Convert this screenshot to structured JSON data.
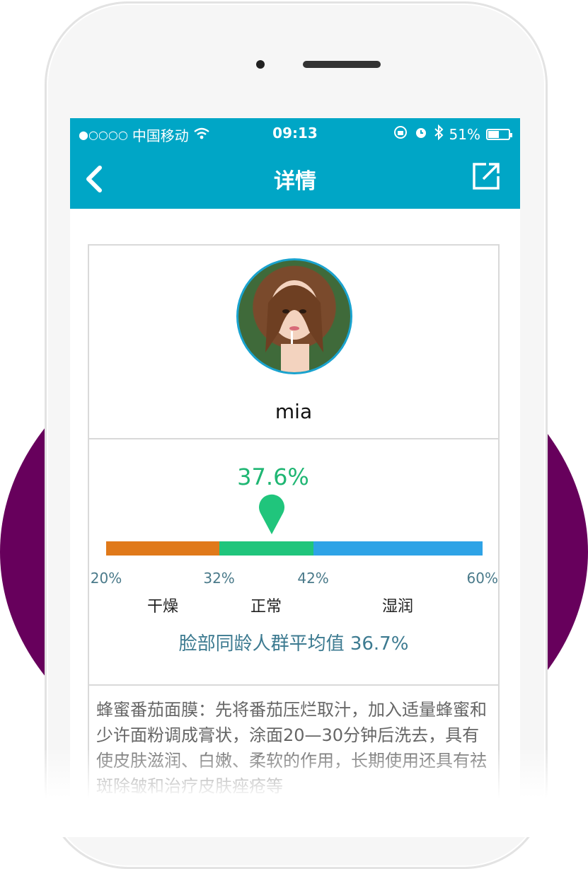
{
  "status_bar": {
    "signal": "●○○○○",
    "carrier": "中国移动",
    "time": "09:13",
    "battery": "51%",
    "battery_level": 0.51
  },
  "nav": {
    "title": "详情"
  },
  "profile": {
    "username": "mia"
  },
  "moisture": {
    "value_text": "37.6%",
    "value": 37.6,
    "ticks": [
      "20%",
      "32%",
      "42%",
      "60%"
    ],
    "zones": [
      "干燥",
      "正常",
      "湿润"
    ],
    "segments": [
      {
        "from": 20,
        "to": 32,
        "color": "#e0791a"
      },
      {
        "from": 32,
        "to": 42,
        "color": "#20c57c"
      },
      {
        "from": 42,
        "to": 60,
        "color": "#2ea3e6"
      }
    ],
    "average_label": "脸部同龄人群平均值 36.7%"
  },
  "tip": {
    "text": "蜂蜜番茄面膜：先将番茄压烂取汁，加入适量蜂蜜和少许面粉调成膏状，涂面20—30分钟后洗去，具有使皮肤滋润、白嫩、柔软的作用，长期使用还具有祛斑除皱和治疗皮肤痤疮等"
  },
  "colors": {
    "accent": "#00a6c6",
    "background_circle": "#67005c",
    "value_green": "#1fb673",
    "average_blue": "#3c7a90"
  }
}
